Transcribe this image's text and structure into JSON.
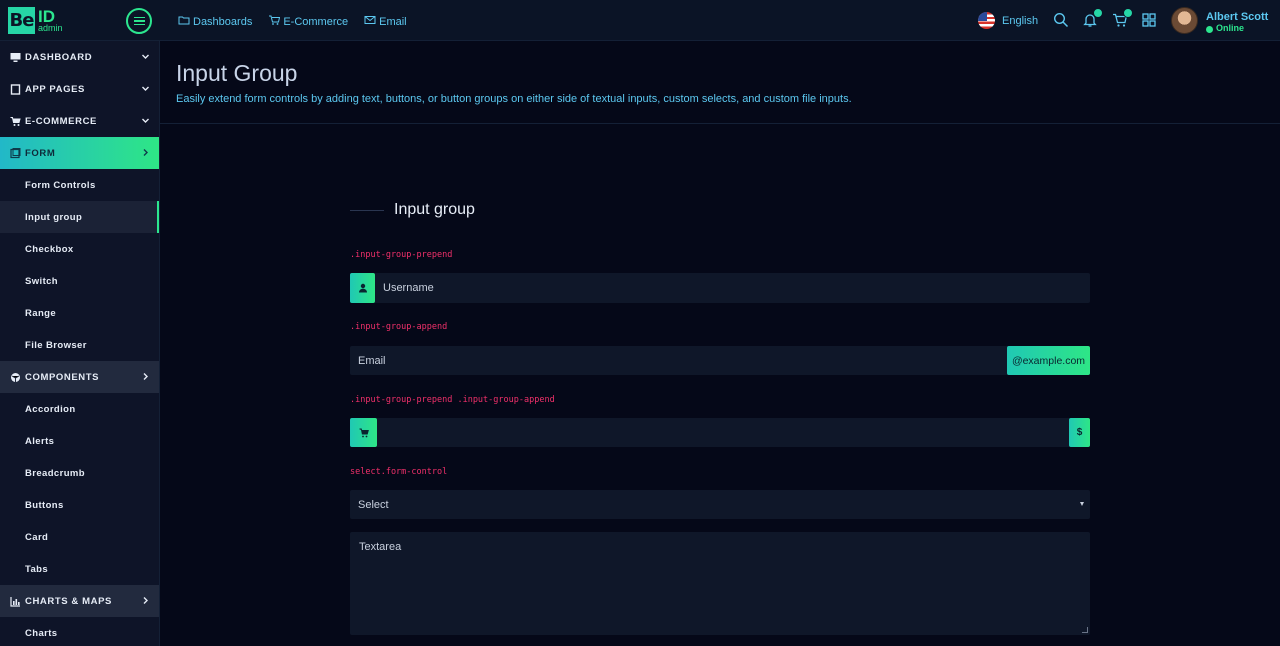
{
  "brand": {
    "logo_mark": "Be",
    "logo_id": "ID",
    "logo_sub": "admin",
    "accent": "#2ce68f",
    "accent2": "#26d6a6"
  },
  "topnav": [
    {
      "label": "Dashboards",
      "icon": "folder-icon"
    },
    {
      "label": "E-Commerce",
      "icon": "cart-icon"
    },
    {
      "label": "Email",
      "icon": "mail-icon"
    }
  ],
  "header": {
    "language": "English",
    "user_name": "Albert Scott",
    "user_status": "Online"
  },
  "sidebar": {
    "sections": [
      {
        "label": "DASHBOARD",
        "icon": "monitor-icon"
      },
      {
        "label": "APP PAGES",
        "icon": "tablet-icon"
      },
      {
        "label": "E-COMMERCE",
        "icon": "cart-icon"
      },
      {
        "label": "FORM",
        "icon": "form-icon"
      },
      {
        "label": "COMPONENTS",
        "icon": "cube-icon"
      },
      {
        "label": "CHARTS & MAPS",
        "icon": "chart-icon"
      }
    ],
    "form_items": [
      "Form Controls",
      "Input group",
      "Checkbox",
      "Switch",
      "Range",
      "File Browser"
    ],
    "component_items": [
      "Accordion",
      "Alerts",
      "Breadcrumb",
      "Buttons",
      "Card",
      "Tabs"
    ],
    "chart_items": [
      "Charts"
    ]
  },
  "page": {
    "title": "Input Group",
    "subtitle": "Easily extend form controls by adding text, buttons, or button groups on either side of textual inputs, custom selects, and custom file inputs."
  },
  "card": {
    "title": "Input group",
    "label_prepend": ".input-group-prepend",
    "label_append": ".input-group-append",
    "label_both": ".input-group-prepend .input-group-append",
    "label_select": "select.form-control",
    "username_placeholder": "Username",
    "email_placeholder": "Email",
    "email_addon": "@example.com",
    "dollar_addon": "$",
    "select_value": "Select",
    "textarea_placeholder": "Textarea"
  }
}
